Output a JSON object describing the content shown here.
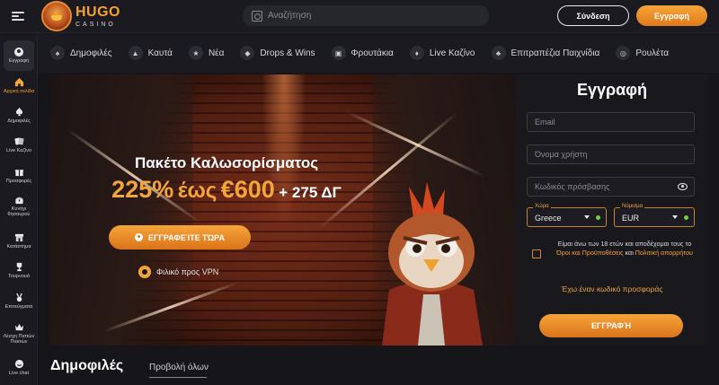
{
  "header": {
    "logo_name": "HUGO",
    "logo_sub": "CASINO",
    "search_placeholder": "Αναζήτηση",
    "login_label": "Σύνδεση",
    "register_label": "Εγγραφή"
  },
  "sidebar": {
    "items": [
      {
        "label": "Εγγραφή",
        "icon": "user-icon"
      },
      {
        "label": "Αρχική σελίδα",
        "icon": "home-icon"
      },
      {
        "label": "Δημοφιλές",
        "icon": "spade-icon"
      },
      {
        "label": "Live Καζίνο",
        "icon": "cards-icon"
      },
      {
        "label": "Προσφορές",
        "icon": "gift-icon"
      },
      {
        "label": "Κυνήγι θησαυρού",
        "icon": "treasure-icon"
      },
      {
        "label": "Κατάστημα",
        "icon": "shop-icon"
      },
      {
        "label": "Τουρνουά",
        "icon": "trophy-icon"
      },
      {
        "label": "Επιτεύγματα",
        "icon": "medal-icon"
      },
      {
        "label": "Λέσχη Πιστών Πακτών",
        "icon": "crown-icon"
      },
      {
        "label": "Live chat",
        "icon": "chat-icon"
      }
    ]
  },
  "categories": [
    {
      "label": "Δημοφιλές",
      "icon": "spade-icon"
    },
    {
      "label": "Καυτά",
      "icon": "flame-icon"
    },
    {
      "label": "Νέα",
      "icon": "new-icon"
    },
    {
      "label": "Drops & Wins",
      "icon": "drops-icon"
    },
    {
      "label": "Φρουτάκια",
      "icon": "slot-icon"
    },
    {
      "label": "Live Καζίνο",
      "icon": "cards-icon"
    },
    {
      "label": "Επιτραπέζια Παιχνίδια",
      "icon": "table-games-icon"
    },
    {
      "label": "Ρουλέτα",
      "icon": "roulette-icon"
    }
  ],
  "hero": {
    "title": "Πακέτο Καλωσορίσματος",
    "percent": "225%",
    "up_to": "έως",
    "amount": "€600",
    "extra": "+ 275 ΔΓ",
    "cta_label": "ΕΓΓΡΑΦΕΊΤΕ ΤΏΡΑ",
    "vpn_label": "Φιλικό προς VPN"
  },
  "register_form": {
    "title": "Εγγραφή",
    "email_placeholder": "Email",
    "username_placeholder": "Όνομα χρήστη",
    "password_placeholder": "Κωδικός πρόσβασης",
    "country_caption": "Χώρα",
    "country_value": "Greece",
    "currency_caption": "Νόμισμα",
    "currency_value": "EUR",
    "terms_prefix": "Είμαι άνω των 18 ετών και αποδέχομαι τους",
    "terms_to": "το",
    "terms_link": "Όροι και Προϋποθέσεις",
    "terms_and": "και",
    "privacy_link": "Πολιτική απορρήτου",
    "promo_label": "Έχω έναν κωδικό προσφοράς",
    "submit_label": "ΕΓΓΡΑΦΉ"
  },
  "popular_section": {
    "title": "Δημοφιλές",
    "view_all": "Προβολή όλων"
  },
  "colors": {
    "accent": "#f3a43d",
    "background": "#15151a",
    "panel": "#18181d",
    "success": "#7ccf3a"
  }
}
